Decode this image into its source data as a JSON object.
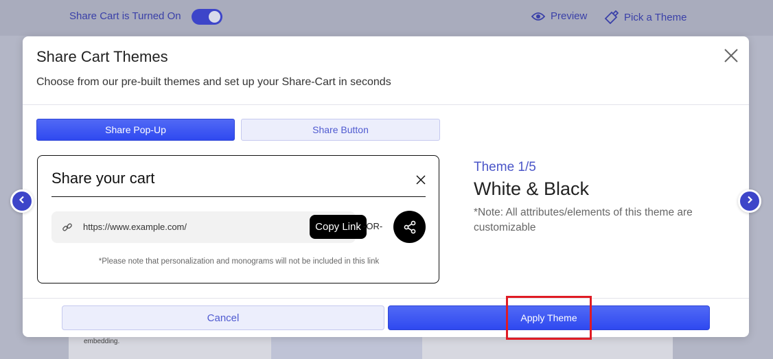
{
  "background": {
    "toggle_label": "Share Cart is Turned On",
    "toggle_state": "on",
    "preview_link": "Preview",
    "pick_theme_link": "Pick a Theme",
    "bottom_text": "embedding."
  },
  "modal": {
    "title": "Share Cart Themes",
    "subtitle": "Choose from our pre-built themes and set up your Share-Cart in seconds",
    "tabs": [
      {
        "label": "Share Pop-Up",
        "active": true
      },
      {
        "label": "Share Button",
        "active": false
      }
    ],
    "preview": {
      "title": "Share your cart",
      "url": "https://www.example.com/",
      "copy_label": "Copy Link",
      "or_label": "-OR-",
      "note": "*Please note that personalization and monograms will not be included in this link"
    },
    "theme": {
      "counter": "Theme 1/5",
      "name": "White & Black",
      "note": "*Note: All attributes/elements of this theme are customizable"
    },
    "cancel_label": "Cancel",
    "apply_label": "Apply Theme"
  },
  "colors": {
    "accent": "#3d45c9",
    "button_gradient_top": "#5169f5",
    "highlight": "#e01b24"
  },
  "icons": [
    "eye-icon",
    "paintbrush-icon",
    "close-icon",
    "link-icon",
    "share-icon",
    "chevron-left-icon",
    "chevron-right-icon"
  ]
}
